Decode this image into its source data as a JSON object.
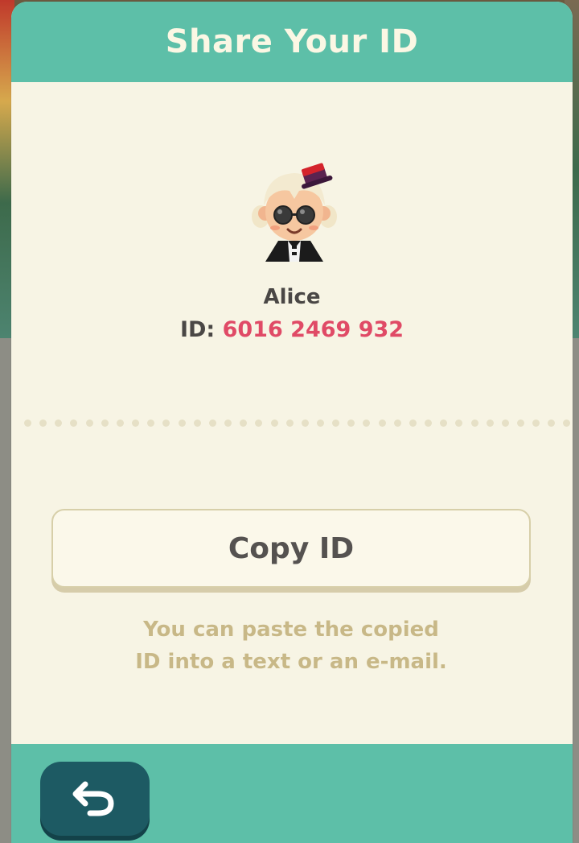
{
  "dialog": {
    "title": "Share Your ID",
    "player_name": "Alice",
    "id_label": "ID:",
    "id_value": "6016 2469 932",
    "copy_button_label": "Copy ID",
    "hint_line1": "You can paste the copied",
    "hint_line2": "ID into a text or an e-mail."
  },
  "icons": {
    "back": "back-arrow-icon",
    "avatar": "player-avatar"
  },
  "colors": {
    "header": "#5dbfa8",
    "panel": "#f7f4e4",
    "id_value": "#e04a66",
    "back_button": "#1d5a63"
  }
}
